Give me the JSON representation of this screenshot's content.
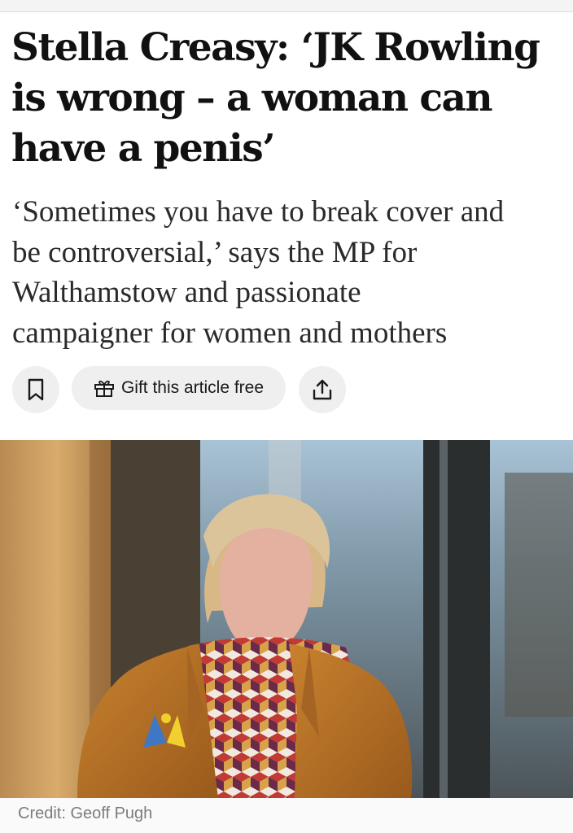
{
  "article": {
    "headline_lines": [
      "Stella Creasy: ‘JK Rowling",
      "is wrong – a woman can",
      "have a penis’"
    ],
    "standfirst_lines": [
      "‘Sometimes you have to break cover and",
      "be controversial,’ says the MP for",
      "Walthamstow and passionate",
      "campaigner for women and mothers"
    ]
  },
  "actions": {
    "bookmark_icon": "bookmark-icon",
    "gift_icon": "gift-icon",
    "gift_label": "Gift this article free",
    "share_icon": "share-icon"
  },
  "photo": {
    "credit": "Credit: Geoff Pugh"
  }
}
